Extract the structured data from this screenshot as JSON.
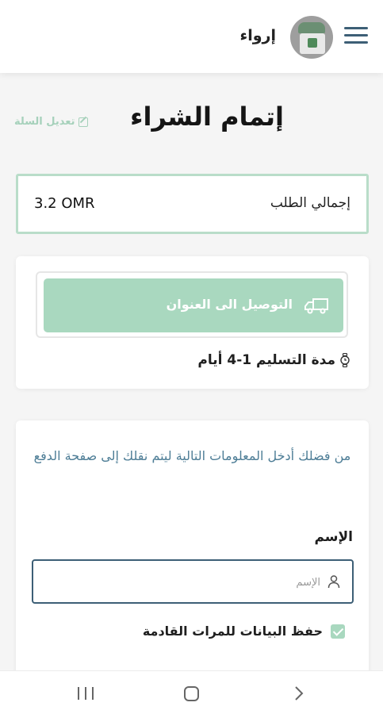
{
  "header": {
    "shop_name": "إرواء",
    "menu_icon": "hamburger-menu-icon",
    "avatar_icon": "store-logo-avatar"
  },
  "checkout": {
    "title": "إتمام الشراء",
    "edit_cart": "تعديل السلة"
  },
  "order_total": {
    "label": "إجمالي الطلب",
    "value": "3.2 OMR"
  },
  "delivery": {
    "button_label": "التوصيل الى العنوان",
    "time_text": "مدة التسليم 1-4 أيام"
  },
  "form": {
    "intro": "من فضلك أدخل المعلومات التالية ليتم نقلك إلى صفحة الدفع",
    "name_label": "الإسم",
    "name_placeholder": "الإسم",
    "name_value": "",
    "save_label": "حفظ البيانات للمرات القادمة",
    "save_checked": true
  },
  "colors": {
    "accent_green": "#a9d8bf",
    "dark_blue": "#3d5f76",
    "intro_text": "#4d7d96"
  },
  "system_nav": {
    "icons": [
      "recents-icon",
      "home-icon",
      "back-icon"
    ]
  }
}
